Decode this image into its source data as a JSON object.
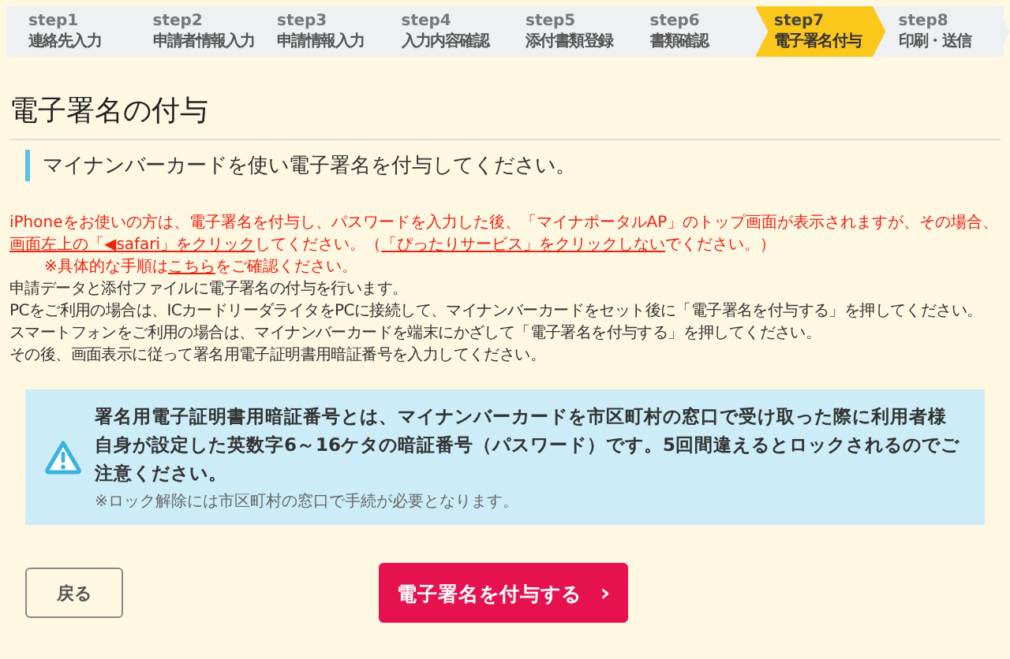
{
  "steps": [
    {
      "step": "step1",
      "label": "連絡先入力",
      "selected": false
    },
    {
      "step": "step2",
      "label": "申請者情報入力",
      "selected": false
    },
    {
      "step": "step3",
      "label": "申請情報入力",
      "selected": false
    },
    {
      "step": "step4",
      "label": "入力内容確認",
      "selected": false
    },
    {
      "step": "step5",
      "label": "添付書類登録",
      "selected": false
    },
    {
      "step": "step6",
      "label": "書類確認",
      "selected": false
    },
    {
      "step": "step7",
      "label": "電子署名付与",
      "selected": true
    },
    {
      "step": "step8",
      "label": "印刷・送信",
      "selected": false
    }
  ],
  "title": "電子署名の付与",
  "subtitle": "マイナンバーカードを使い電子署名を付与してください。",
  "notice": [
    {
      "kind": "text",
      "text": "iPhoneをお使いの方は、電子署名を付与し、パスワードを入力した後、「マイナポータルAP」のトップ画面が表示されますが、その場合、"
    },
    {
      "kind": "link",
      "text": "画面左上の「◀safari」をクリック"
    },
    {
      "kind": "text",
      "text": "してください。（"
    },
    {
      "kind": "link",
      "text": "「ぴったりサービス」をクリックしない"
    },
    {
      "kind": "text",
      "text": "でください。）"
    }
  ],
  "notice_note": [
    {
      "kind": "text",
      "text": "※具体的な手順は"
    },
    {
      "kind": "link",
      "text": "こちら"
    },
    {
      "kind": "text",
      "text": "をご確認ください。"
    }
  ],
  "instructions": [
    "申請データと添付ファイルに電子署名の付与を行います。",
    "PCをご利用の場合は、ICカードリーダライタをPCに接続して、マイナンバーカードをセット後に「電子署名を付与する」を押してください。",
    "スマートフォンをご利用の場合は、マイナンバーカードを端末にかざして「電子署名を付与する」を押してください。",
    "その後、画面表示に従って署名用電子証明書用暗証番号を入力してください。"
  ],
  "alert": {
    "message": "署名用電子証明書用暗証番号とは、マイナンバーカードを市区町村の窓口で受け取った際に利用者様自身が設定した英数字6～16ケタの暗証番号（パスワード）です。5回間違えるとロックされるのでご注意ください。",
    "note": "※ロック解除には市区町村の窓口で手続が必要となります。"
  },
  "buttons": {
    "back": "戻る",
    "submit": "電子署名を付与する",
    "submit_icon": "›"
  }
}
